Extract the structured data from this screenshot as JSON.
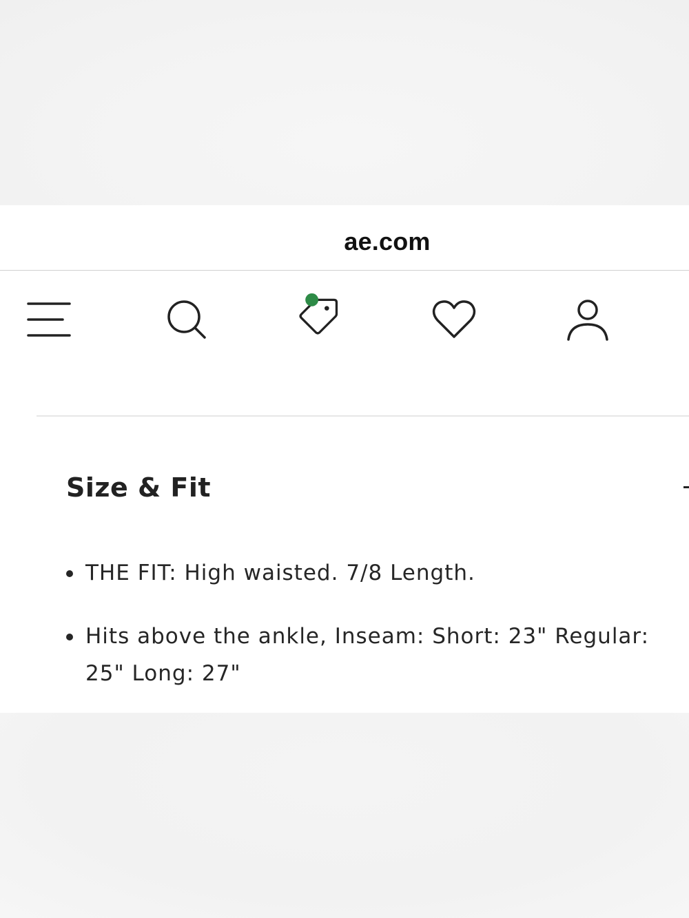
{
  "browser": {
    "url": "ae.com"
  },
  "nav": {
    "items": [
      {
        "icon": "menu-icon"
      },
      {
        "icon": "search-icon"
      },
      {
        "icon": "tag-icon",
        "badge_color": "#2e8b47"
      },
      {
        "icon": "heart-icon"
      },
      {
        "icon": "user-icon"
      }
    ]
  },
  "size_fit": {
    "title": "Size & Fit",
    "toggle_symbol": "-",
    "bullets": [
      "THE FIT: High waisted. 7/8 Length.",
      "Hits above the ankle, Inseam: Short: 23\" Regular: 25\" Long: 27\""
    ]
  }
}
